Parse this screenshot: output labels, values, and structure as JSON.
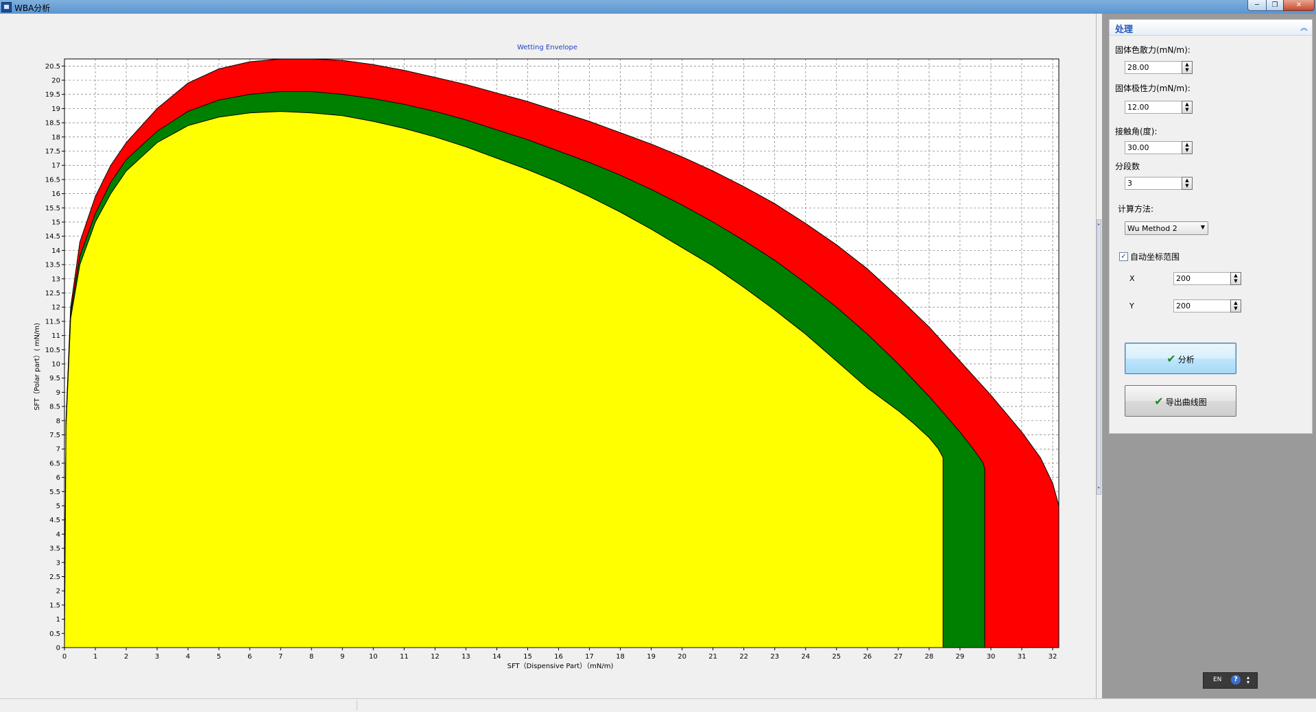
{
  "window": {
    "title": "WBA分析",
    "min_label": "─",
    "max_label": "❐",
    "close_label": "✕"
  },
  "panel": {
    "title": "处理",
    "fields": {
      "dispersive_label": "固体色散力(mN/m):",
      "dispersive_value": "28.00",
      "polar_label": "固体极性力(mN/m):",
      "polar_value": "12.00",
      "angle_label": "接触角(度):",
      "angle_value": "30.00",
      "segments_label": "分段数",
      "segments_value": "3",
      "method_label": "计算方法:",
      "method_value": "Wu Method 2",
      "auto_range_label": "自动坐标范围",
      "auto_range_checked": true,
      "x_label": "X",
      "x_value": "200",
      "y_label": "Y",
      "y_value": "200"
    },
    "analyze_label": "分析",
    "export_label": "导出曲线图"
  },
  "lang": {
    "code": "EN",
    "help": "?"
  },
  "chart_data": {
    "type": "area",
    "title": "Wetting Envelope",
    "xlabel": "SFT（Dispensive Part）（mN/m)",
    "ylabel": "SFT（Polar part）( mN/m)",
    "xlim": [
      0,
      32.2
    ],
    "ylim": [
      0,
      20.75
    ],
    "grid": true,
    "x_ticks": [
      "0",
      "1",
      "2",
      "3",
      "4",
      "5",
      "6",
      "7",
      "8",
      "9",
      "10",
      "11",
      "12",
      "13",
      "14",
      "15",
      "16",
      "17",
      "18",
      "19",
      "20",
      "21",
      "22",
      "23",
      "24",
      "25",
      "26",
      "27",
      "28",
      "29",
      "30",
      "31",
      "32"
    ],
    "y_ticks": [
      "0",
      "0.5",
      "1",
      "1.5",
      "2",
      "2.5",
      "3",
      "3.5",
      "4",
      "4.5",
      "5",
      "5.5",
      "6",
      "6.5",
      "7",
      "7.5",
      "8",
      "8.5",
      "9",
      "9.5",
      "10",
      "10.5",
      "11",
      "11.5",
      "12",
      "12.5",
      "13",
      "13.5",
      "14",
      "14.5",
      "15",
      "15.5",
      "16",
      "16.5",
      "17",
      "17.5",
      "18",
      "18.5",
      "19",
      "19.5",
      "20",
      "20.5"
    ],
    "series": [
      {
        "color": "#ff0000",
        "x": [
          0,
          0.05,
          0.2,
          0.5,
          1,
          1.5,
          2,
          3,
          4,
          5,
          6,
          7,
          8,
          9,
          10,
          11,
          12,
          13,
          14,
          15,
          16,
          17,
          18,
          19,
          20,
          21,
          22,
          23,
          24,
          25,
          26,
          27,
          28,
          29,
          30,
          31,
          31.6,
          32.0,
          32.2,
          32.2
        ],
        "y": [
          0,
          8.0,
          12.0,
          14.3,
          15.9,
          17.0,
          17.8,
          19.0,
          19.9,
          20.4,
          20.65,
          20.75,
          20.75,
          20.7,
          20.55,
          20.35,
          20.1,
          19.85,
          19.55,
          19.25,
          18.9,
          18.55,
          18.15,
          17.75,
          17.3,
          16.8,
          16.25,
          15.65,
          14.95,
          14.2,
          13.35,
          12.35,
          11.3,
          10.1,
          8.9,
          7.6,
          6.7,
          5.8,
          5.0,
          0
        ]
      },
      {
        "color": "#008000",
        "x": [
          0,
          0.05,
          0.2,
          0.5,
          1,
          1.5,
          2,
          3,
          4,
          5,
          6,
          7,
          8,
          9,
          10,
          11,
          12,
          13,
          14,
          15,
          16,
          17,
          18,
          19,
          20,
          21,
          22,
          23,
          24,
          25,
          26,
          27,
          28,
          29,
          29.5,
          29.75,
          29.8,
          29.8
        ],
        "y": [
          0,
          8.0,
          11.8,
          13.8,
          15.3,
          16.4,
          17.2,
          18.2,
          18.9,
          19.3,
          19.5,
          19.6,
          19.6,
          19.5,
          19.35,
          19.15,
          18.9,
          18.6,
          18.25,
          17.9,
          17.5,
          17.1,
          16.65,
          16.15,
          15.6,
          15.0,
          14.35,
          13.65,
          12.85,
          12.0,
          11.05,
          10.0,
          8.85,
          7.6,
          6.9,
          6.5,
          6.3,
          0
        ]
      },
      {
        "color": "#ffff00",
        "x": [
          0,
          0.05,
          0.2,
          0.5,
          1,
          1.5,
          2,
          3,
          4,
          5,
          6,
          7,
          8,
          9,
          10,
          11,
          12,
          13,
          14,
          15,
          16,
          17,
          18,
          19,
          20,
          21,
          22,
          23,
          24,
          25,
          26,
          27,
          27.5,
          28,
          28.3,
          28.45,
          28.45
        ],
        "y": [
          0,
          7.8,
          11.6,
          13.5,
          15.0,
          16.0,
          16.8,
          17.8,
          18.4,
          18.7,
          18.85,
          18.9,
          18.85,
          18.75,
          18.55,
          18.3,
          18.0,
          17.65,
          17.25,
          16.85,
          16.4,
          15.9,
          15.35,
          14.75,
          14.1,
          13.45,
          12.7,
          11.9,
          11.05,
          10.1,
          9.15,
          8.35,
          7.9,
          7.4,
          7.0,
          6.7,
          0
        ]
      }
    ]
  }
}
